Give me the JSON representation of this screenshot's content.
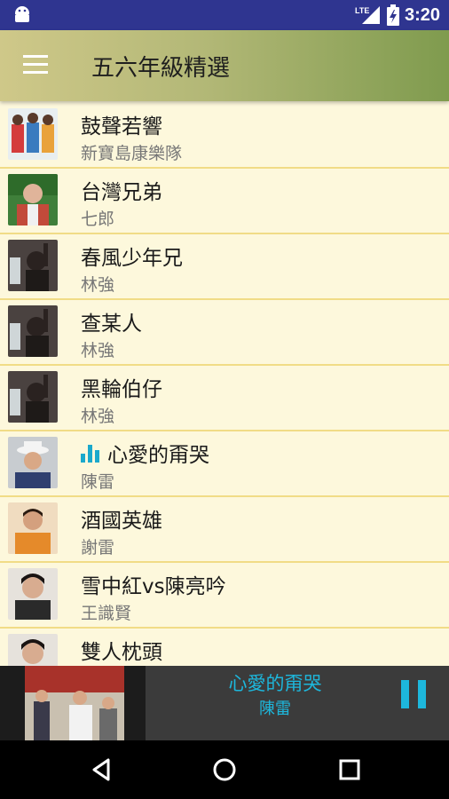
{
  "status_bar": {
    "network": "LTE",
    "time": "3:20"
  },
  "toolbar": {
    "menu_icon": "hamburger-menu-icon",
    "title": "五六年級精選"
  },
  "songs": [
    {
      "title": "鼓聲若響",
      "artist": "新寶島康樂隊",
      "playing": false
    },
    {
      "title": "台灣兄弟",
      "artist": "七郎",
      "playing": false
    },
    {
      "title": "春風少年兄",
      "artist": "林強",
      "playing": false
    },
    {
      "title": "查某人",
      "artist": "林強",
      "playing": false
    },
    {
      "title": "黑輪伯仔",
      "artist": "林強",
      "playing": false
    },
    {
      "title": "心愛的甭哭",
      "artist": "陳雷",
      "playing": true
    },
    {
      "title": "酒國英雄",
      "artist": "謝雷",
      "playing": false
    },
    {
      "title": "雪中紅vs陳亮吟",
      "artist": "王識賢",
      "playing": false
    },
    {
      "title": "雙人枕頭",
      "artist": "",
      "playing": false
    }
  ],
  "now_playing": {
    "title": "心愛的甭哭",
    "artist": "陳雷",
    "control_icon": "pause-icon"
  },
  "colors": {
    "accent": "#1db7dc",
    "list_bg": "#fdf8dc",
    "divider": "#f1dc86",
    "status_bar": "#2f3590"
  }
}
